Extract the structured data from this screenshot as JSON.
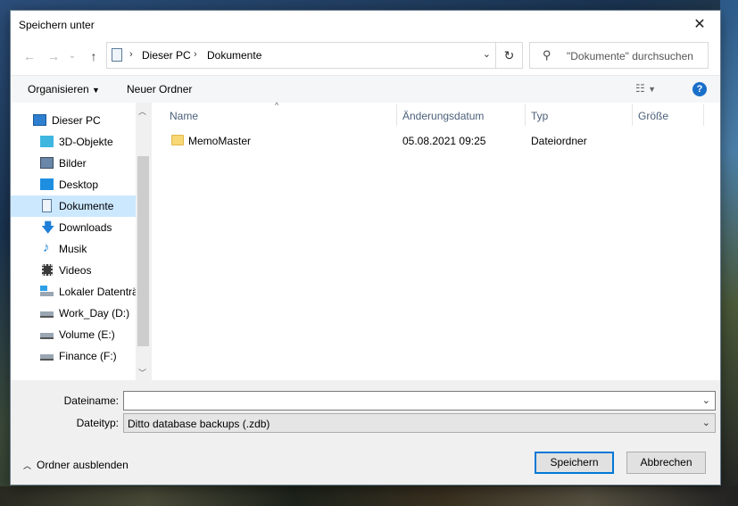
{
  "window": {
    "title": "Speichern unter"
  },
  "nav": {
    "back": "←",
    "forward": "→",
    "recent": "⌄",
    "up": "↑",
    "refresh": "↻",
    "breadcrumb": [
      "Dieser PC",
      "Dokumente"
    ],
    "search_placeholder": "\"Dokumente\" durchsuchen"
  },
  "toolbar": {
    "organize": "Organisieren",
    "new_folder": "Neuer Ordner",
    "help": "?"
  },
  "sidebar": {
    "items": [
      {
        "label": "Dieser PC",
        "icon": "computer-icon"
      },
      {
        "label": "3D-Objekte",
        "icon": "cube-icon"
      },
      {
        "label": "Bilder",
        "icon": "pictures-icon"
      },
      {
        "label": "Desktop",
        "icon": "desktop-icon"
      },
      {
        "label": "Dokumente",
        "icon": "documents-icon",
        "selected": true
      },
      {
        "label": "Downloads",
        "icon": "download-icon"
      },
      {
        "label": "Musik",
        "icon": "music-icon"
      },
      {
        "label": "Videos",
        "icon": "video-icon"
      },
      {
        "label": "Lokaler Datenträ",
        "icon": "local-drive-icon"
      },
      {
        "label": "Work_Day (D:)",
        "icon": "drive-icon"
      },
      {
        "label": "Volume (E:)",
        "icon": "drive-icon"
      },
      {
        "label": "Finance (F:)",
        "icon": "drive-icon"
      }
    ]
  },
  "columns": {
    "name": "Name",
    "modified": "Änderungsdatum",
    "type": "Typ",
    "size": "Größe"
  },
  "files": [
    {
      "name": "MemoMaster",
      "modified": "05.08.2021 09:25",
      "type": "Dateiordner",
      "size": ""
    }
  ],
  "form": {
    "filename_label": "Dateiname:",
    "filename_value": "",
    "filetype_label": "Dateityp:",
    "filetype_value": "Ditto database backups (.zdb)"
  },
  "buttons": {
    "hide_folders": "Ordner ausblenden",
    "save": "Speichern",
    "cancel": "Abbrechen"
  },
  "colors": {
    "selection": "#cce8ff",
    "accent": "#0078d7",
    "header_text": "#4c607a"
  }
}
